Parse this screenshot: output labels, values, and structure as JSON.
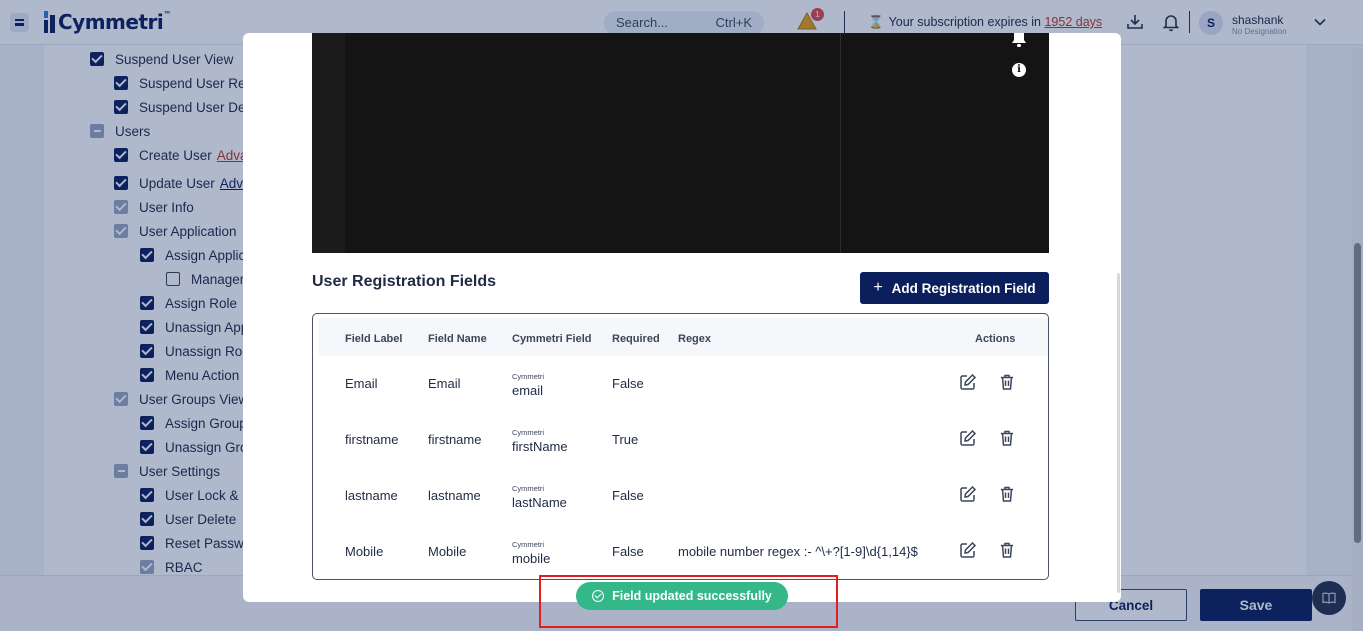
{
  "header": {
    "brand": "Cymmetri",
    "search_placeholder": "Search...",
    "search_shortcut": "Ctrl+K",
    "alert_count": "1",
    "subscription_prefix": "Your subscription expires in",
    "subscription_days": "1952 days",
    "user_initial": "S",
    "user_name": "shashank",
    "user_designation": "No Designation"
  },
  "permissions": [
    {
      "label": "Suspend User View",
      "state": "on",
      "indent": 0
    },
    {
      "label": "Suspend User Re",
      "state": "on",
      "indent": 1
    },
    {
      "label": "Suspend User De",
      "state": "on",
      "indent": 1
    },
    {
      "label": "Users",
      "state": "ind",
      "indent": 0
    },
    {
      "label": "Create User",
      "state": "on",
      "indent": 1,
      "link": "Adva",
      "link_color": "red"
    },
    {
      "label": "Update User",
      "state": "on",
      "indent": 1,
      "link": "Adv",
      "link_color": "blue"
    },
    {
      "label": "User Info",
      "state": "dim",
      "indent": 1
    },
    {
      "label": "User Application",
      "state": "dim",
      "indent": 1
    },
    {
      "label": "Assign Applic",
      "state": "on",
      "indent": 2
    },
    {
      "label": "Manager",
      "state": "off",
      "indent": 3
    },
    {
      "label": "Assign Role",
      "state": "on",
      "indent": 2
    },
    {
      "label": "Unassign App",
      "state": "on",
      "indent": 2
    },
    {
      "label": "Unassign Rol",
      "state": "on",
      "indent": 2
    },
    {
      "label": "Menu Action",
      "state": "on",
      "indent": 2
    },
    {
      "label": "User Groups View",
      "state": "dim",
      "indent": 1
    },
    {
      "label": "Assign Group",
      "state": "on",
      "indent": 2
    },
    {
      "label": "Unassign Gro",
      "state": "on",
      "indent": 2
    },
    {
      "label": "User Settings",
      "state": "ind",
      "indent": 1
    },
    {
      "label": "User Lock & U",
      "state": "on",
      "indent": 2
    },
    {
      "label": "User Delete",
      "state": "on",
      "indent": 2
    },
    {
      "label": "Reset Passw",
      "state": "on",
      "indent": 2
    },
    {
      "label": "RBAC",
      "state": "dim",
      "indent": 2
    }
  ],
  "footer": {
    "cancel_label": "Cancel",
    "save_label": "Save"
  },
  "modal": {
    "section_title": "User Registration Fields",
    "add_button_label": "Add Registration Field",
    "columns": [
      "Field Label",
      "Field Name",
      "Cymmetri Field",
      "Required",
      "Regex",
      "Actions"
    ],
    "rows": [
      {
        "label": "Email",
        "name": "Email",
        "cym_caption": "Cymmetri",
        "cym_field": "email",
        "required": "False",
        "regex": ""
      },
      {
        "label": "firstname",
        "name": "firstname",
        "cym_caption": "Cymmetri",
        "cym_field": "firstName",
        "required": "True",
        "regex": ""
      },
      {
        "label": "lastname",
        "name": "lastname",
        "cym_caption": "Cymmetri",
        "cym_field": "lastName",
        "required": "False",
        "regex": ""
      },
      {
        "label": "Mobile",
        "name": "Mobile",
        "cym_caption": "Cymmetri",
        "cym_field": "mobile",
        "required": "False",
        "regex": "mobile number regex :- ^\\+?[1-9]\\d{1,14}$"
      }
    ]
  },
  "toast": {
    "message": "Field updated successfully"
  },
  "colors": {
    "brand": "#0b1f5c",
    "success": "#34b88a",
    "link_red": "#c0392b"
  }
}
